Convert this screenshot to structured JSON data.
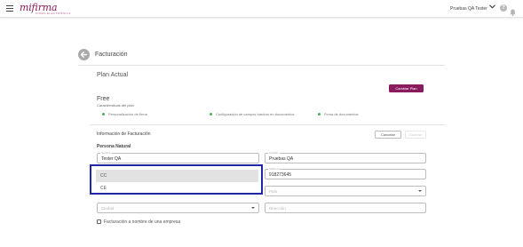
{
  "header": {
    "logo_text": "mifirma",
    "logo_tagline": "FIRMA ELECTRÓNICA",
    "user_name": "Pruebas QA Tester",
    "help_symbol": "?"
  },
  "page": {
    "title": "Facturación"
  },
  "plan": {
    "heading": "Plan Actual",
    "change_button": "Cambiar Plan",
    "name": "Free",
    "features_title": "Características del plan",
    "features": [
      "Personalización de firma",
      "Configuración de campos básicos en documentos",
      "Firma de documentos"
    ],
    "feature_dot_color": "#4caf50"
  },
  "billing": {
    "heading": "Información de Facturación",
    "cancel_button": "Cancelar",
    "save_button": "Guardar",
    "person_type": "Persona Natural",
    "first_name": {
      "label": "Nombre",
      "value": "Tester QA"
    },
    "last_name": {
      "label": "Apellido",
      "value": "Pruebas QA"
    },
    "phone": {
      "label": "Teléfono",
      "value": "918273645"
    },
    "doc_type_options": [
      "CC",
      "CE"
    ],
    "doc_type_selected": "CC",
    "country": {
      "placeholder": "País"
    },
    "city": {
      "placeholder": "Ciudad"
    },
    "address": {
      "placeholder": "Dirección"
    },
    "company_checkbox_label": "Facturación a nombre de una empresa",
    "company_checkbox_checked": false
  },
  "colors": {
    "brand": "#8a1b5c",
    "dropdown_highlight": "#1f27a8"
  }
}
